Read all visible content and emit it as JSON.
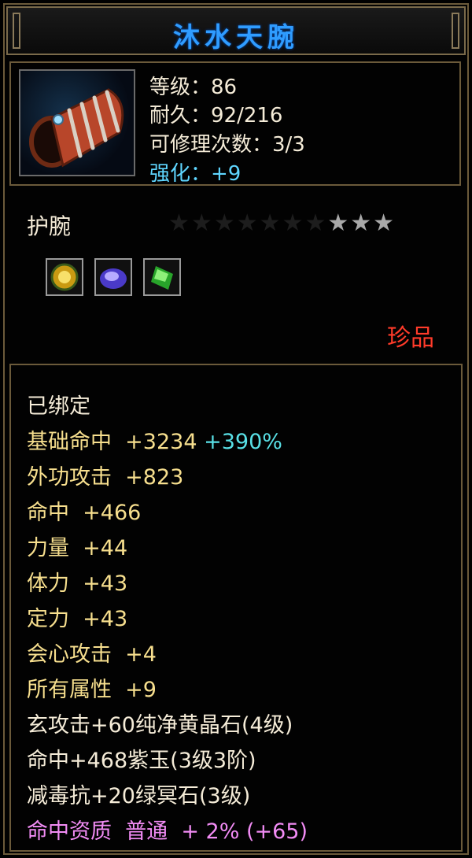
{
  "item": {
    "name": "沐水天腕",
    "level": "等级：86",
    "durability": "耐久：92/216",
    "repairs": "可修理次数：3/3",
    "enhance": "强化：+9",
    "type": "护腕",
    "stars_lit": 3,
    "stars_total": 10,
    "rarity": "珍品",
    "icon": "bracer-icon",
    "gems": [
      {
        "icon": "yellow-crystal-gem-icon",
        "color": "#d9b21a"
      },
      {
        "icon": "purple-jade-gem-icon",
        "color": "#6a5ae8"
      },
      {
        "icon": "green-stone-gem-icon",
        "color": "#3cc23c"
      }
    ]
  },
  "attributes": {
    "bound": "已绑定",
    "base_hit_label": "基础命中",
    "base_hit_value": "+3234",
    "base_hit_pct": "+390%",
    "ext_attack_label": "外功攻击",
    "ext_attack_value": "+823",
    "hit_label": "命中",
    "hit_value": "+466",
    "str_label": "力量",
    "str_value": "+44",
    "con_label": "体力",
    "con_value": "+43",
    "foc_label": "定力",
    "foc_value": "+43",
    "crit_label": "会心攻击",
    "crit_value": "+4",
    "all_label": "所有属性",
    "all_value": "+9",
    "gem_line_1": "玄攻击+60纯净黄晶石(4级)",
    "gem_line_2": "命中+468紫玉(3级3阶)",
    "gem_line_3": "减毒抗+20绿冥石(3级)",
    "aptitude_label": "命中资质",
    "aptitude_grade": "普通",
    "aptitude_bonus": "+ 2% (+65)"
  },
  "colors": {
    "title": "#2f9cff",
    "blue_stat": "#5fd6ff",
    "yellow_stat": "#f7df8e",
    "cyan_pct": "#59e0e6",
    "pink_aptitude": "#f28cf5",
    "rarity_red": "#ff3b2a",
    "border": "#6b5a3a"
  }
}
